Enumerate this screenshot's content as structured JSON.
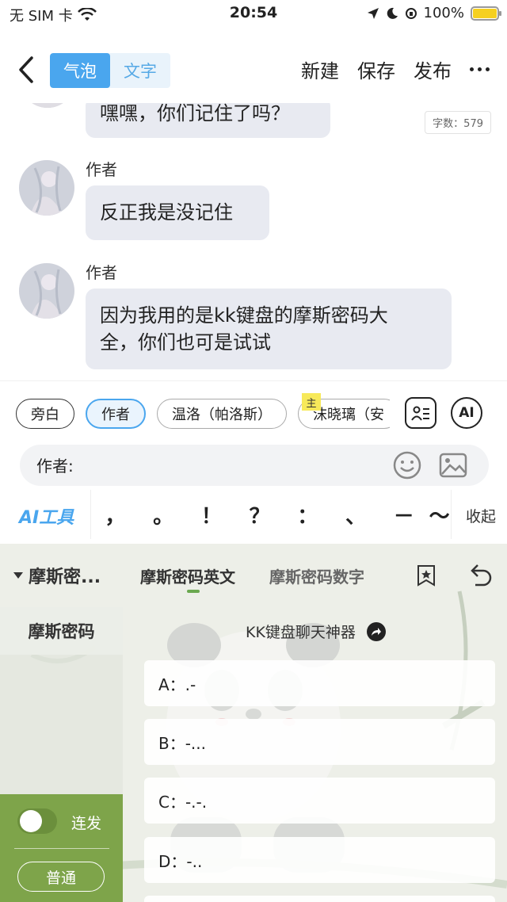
{
  "status_bar": {
    "carrier": "无 SIM 卡",
    "time": "20:54",
    "battery": "100%"
  },
  "nav": {
    "mode_bubble": "气泡",
    "mode_text": "文字",
    "new_label": "新建",
    "save_label": "保存",
    "publish_label": "发布"
  },
  "word_count": "字数：579",
  "messages": [
    {
      "author": "",
      "text": "嘿嘿，你们记住了吗？"
    },
    {
      "author": "作者",
      "text": "反正我是没记住"
    },
    {
      "author": "作者",
      "text_line1": "因为我用的是kk键盘的摩斯密码大",
      "text_line2": "全，你们也可是试试"
    }
  ],
  "roles": {
    "items": [
      "旁白",
      "作者",
      "温洛（帕洛斯）",
      "沫晓璃（安"
    ],
    "active": "作者",
    "main_badge": "主"
  },
  "ai_button": "AI",
  "input": {
    "label": "作者:",
    "placeholder": "",
    "value": ""
  },
  "toolbar": {
    "ai_tools": "AI工具",
    "punctuation": [
      "，",
      "。",
      "！",
      "？",
      "：",
      "、",
      "－",
      "～"
    ],
    "collapse": "收起"
  },
  "keyboard": {
    "dropdown": "摩斯密...",
    "tabs": [
      "摩斯密码英文",
      "摩斯密码数字"
    ],
    "active_tab": "摩斯密码英文",
    "category": "摩斯密码",
    "title": "KK键盘聊天神器",
    "items": [
      "A：.-",
      "B：-...",
      "C：-.-.",
      "D：-.."
    ],
    "toggle_label": "连发",
    "mode_button": "普通"
  },
  "colors": {
    "accent_blue": "#4aa6ee",
    "bubble_bg": "#e8eaf1",
    "sidebar_green": "#7ea44a"
  }
}
